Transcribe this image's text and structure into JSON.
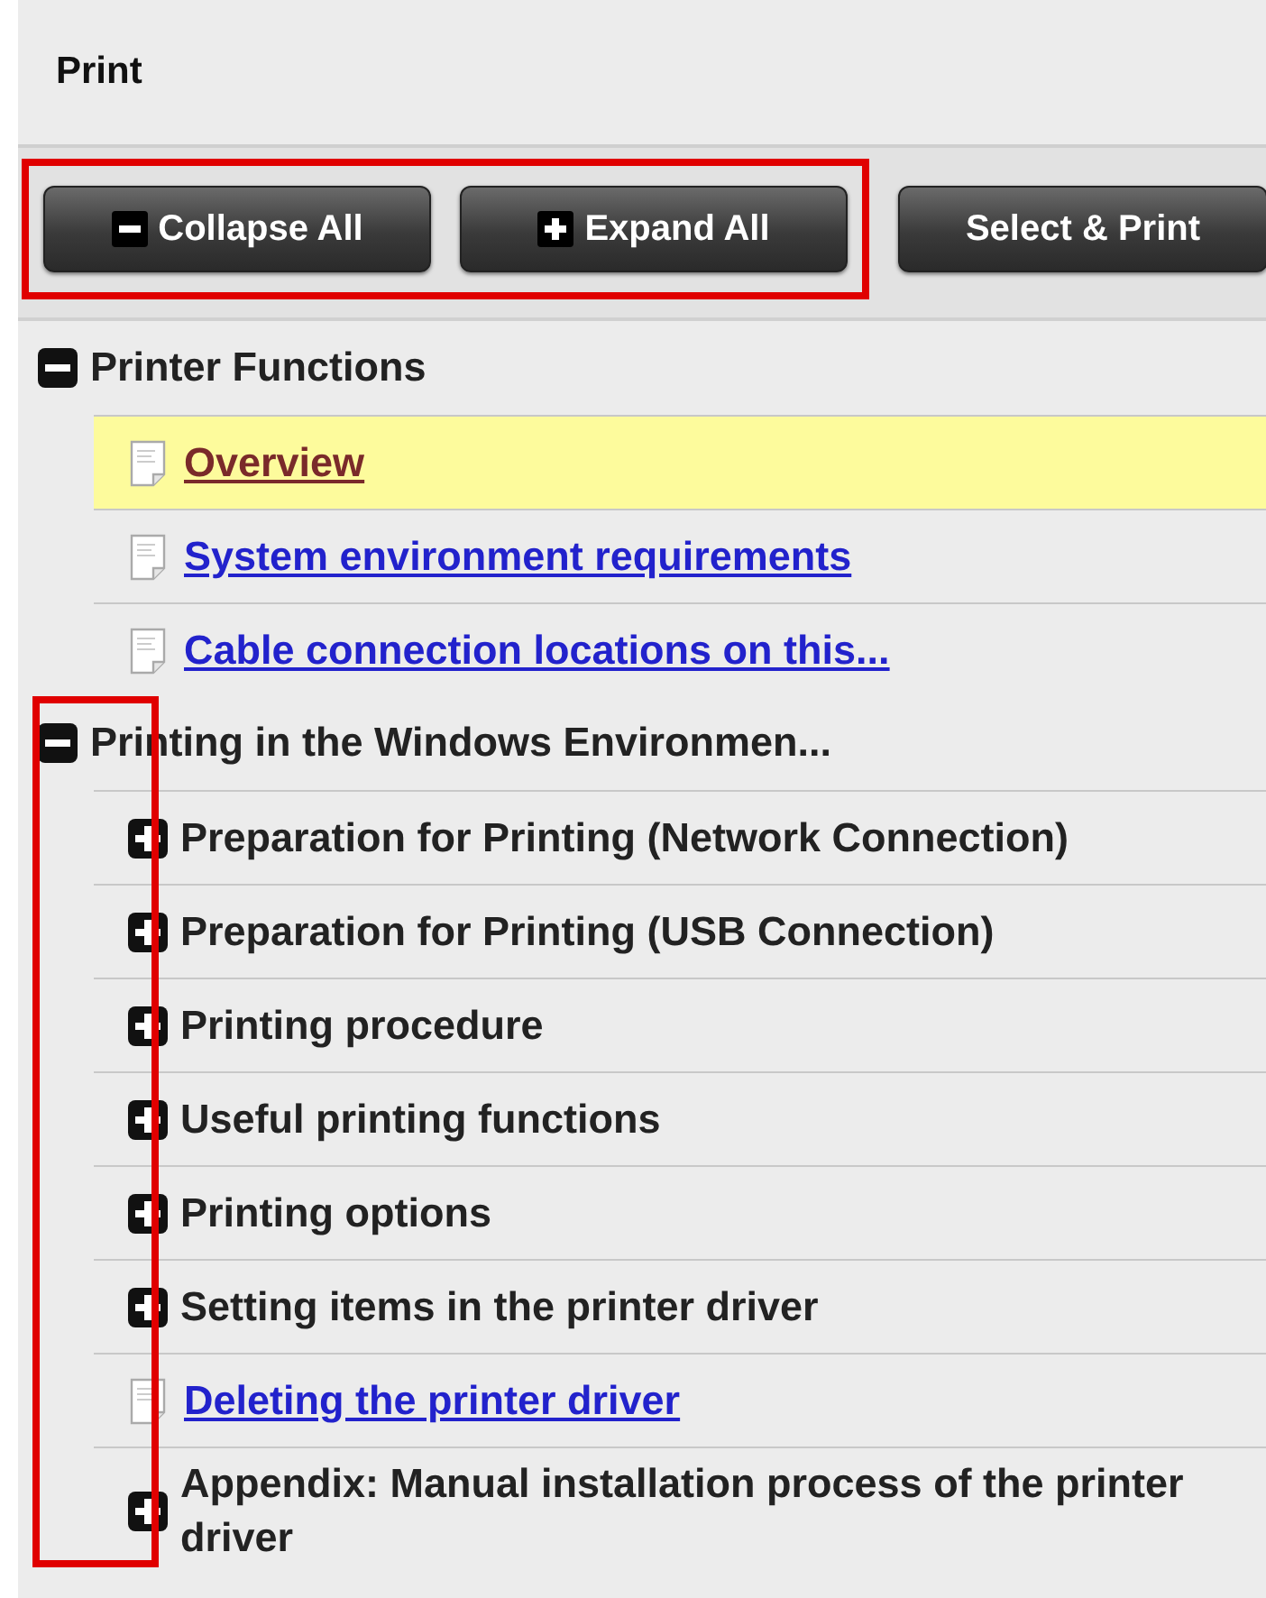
{
  "title": "Print",
  "toolbar": {
    "highlighted": true,
    "buttons": [
      {
        "label": "Collapse All",
        "kind": "collapse"
      },
      {
        "label": "Expand All",
        "kind": "expand"
      },
      {
        "label": "Select & Print",
        "kind": "plain"
      }
    ]
  },
  "tree": {
    "items": [
      {
        "label": "Printer Functions",
        "kind": "folder",
        "expanded": true,
        "highlighted": false,
        "children": [
          {
            "label": "Overview",
            "kind": "page",
            "selected": true
          },
          {
            "label": "System environment requirements",
            "kind": "page",
            "selected": false
          },
          {
            "label": "Cable connection locations on this...",
            "kind": "page",
            "selected": false
          }
        ]
      },
      {
        "label": "Printing in the Windows Environmen...",
        "kind": "folder",
        "expanded": true,
        "highlighted": true,
        "children": [
          {
            "label": "Preparation for Printing (Network Connection)",
            "kind": "folder",
            "expanded": false,
            "selected": false
          },
          {
            "label": "Preparation for Printing (USB Connection)",
            "kind": "folder",
            "expanded": false,
            "selected": false
          },
          {
            "label": "Printing procedure",
            "kind": "folder",
            "expanded": false,
            "selected": false
          },
          {
            "label": "Useful printing functions",
            "kind": "folder",
            "expanded": false,
            "selected": false
          },
          {
            "label": "Printing options",
            "kind": "folder",
            "expanded": false,
            "selected": false
          },
          {
            "label": "Setting items in the printer driver",
            "kind": "folder",
            "expanded": false,
            "selected": false
          },
          {
            "label": "Deleting the printer driver",
            "kind": "page",
            "selected": false
          },
          {
            "label": "Appendix: Manual installation process of the printer driver",
            "kind": "folder",
            "expanded": false,
            "selected": false
          }
        ]
      }
    ]
  }
}
